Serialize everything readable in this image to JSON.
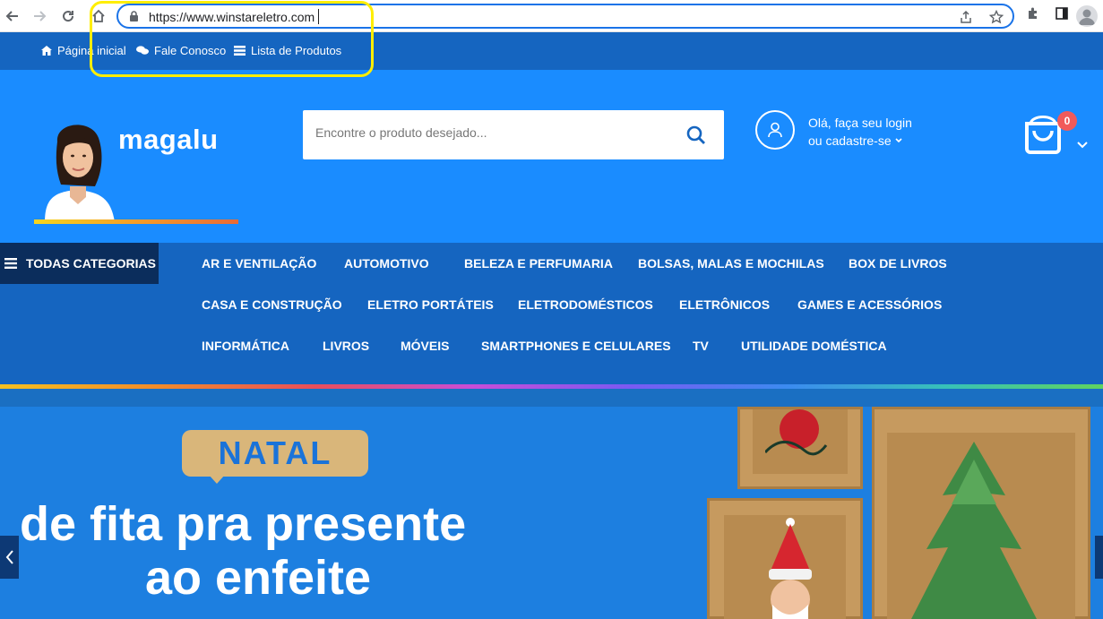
{
  "browser": {
    "url": "https://www.winstareletro.com",
    "back_icon": "back-arrow-icon",
    "forward_icon": "forward-arrow-icon",
    "reload_icon": "reload-icon",
    "home_icon": "home-icon"
  },
  "topbar": {
    "links": [
      {
        "label": "Página inicial",
        "icon": "home-icon"
      },
      {
        "label": "Fale Conosco",
        "icon": "chat-icon"
      },
      {
        "label": "Lista de Produtos",
        "icon": "list-icon"
      }
    ]
  },
  "header": {
    "logo": "magalu",
    "search_placeholder": "Encontre o produto desejado...",
    "login_line1": "Olá, faça seu login",
    "login_line2": "ou cadastre-se",
    "cart_count": "0"
  },
  "categories": {
    "all_label": "TODAS CATEGORIAS",
    "rows": [
      [
        "AR E VENTILAÇÃO",
        "AUTOMOTIVO",
        "BELEZA E PERFUMARIA",
        "BOLSAS, MALAS E MOCHILAS",
        "BOX DE LIVROS"
      ],
      [
        "CASA E CONSTRUÇÃO",
        "ELETRO PORTÁTEIS",
        "ELETRODOMÉSTICOS",
        "ELETRÔNICOS",
        "GAMES E ACESSÓRIOS"
      ],
      [
        "INFORMÁTICA",
        "LIVROS",
        "MÓVEIS",
        "SMARTPHONES E CELULARES",
        "TV",
        "UTILIDADE DOMÉSTICA"
      ]
    ]
  },
  "banner": {
    "tag": "NATAL",
    "headline_line1": "de fita pra presente",
    "headline_line2": "ao enfeite"
  },
  "colors": {
    "header_blue": "#1a8cff",
    "nav_blue": "#1565c0",
    "dark_navy": "#0b2d5c",
    "highlight_yellow": "#ffee00"
  }
}
